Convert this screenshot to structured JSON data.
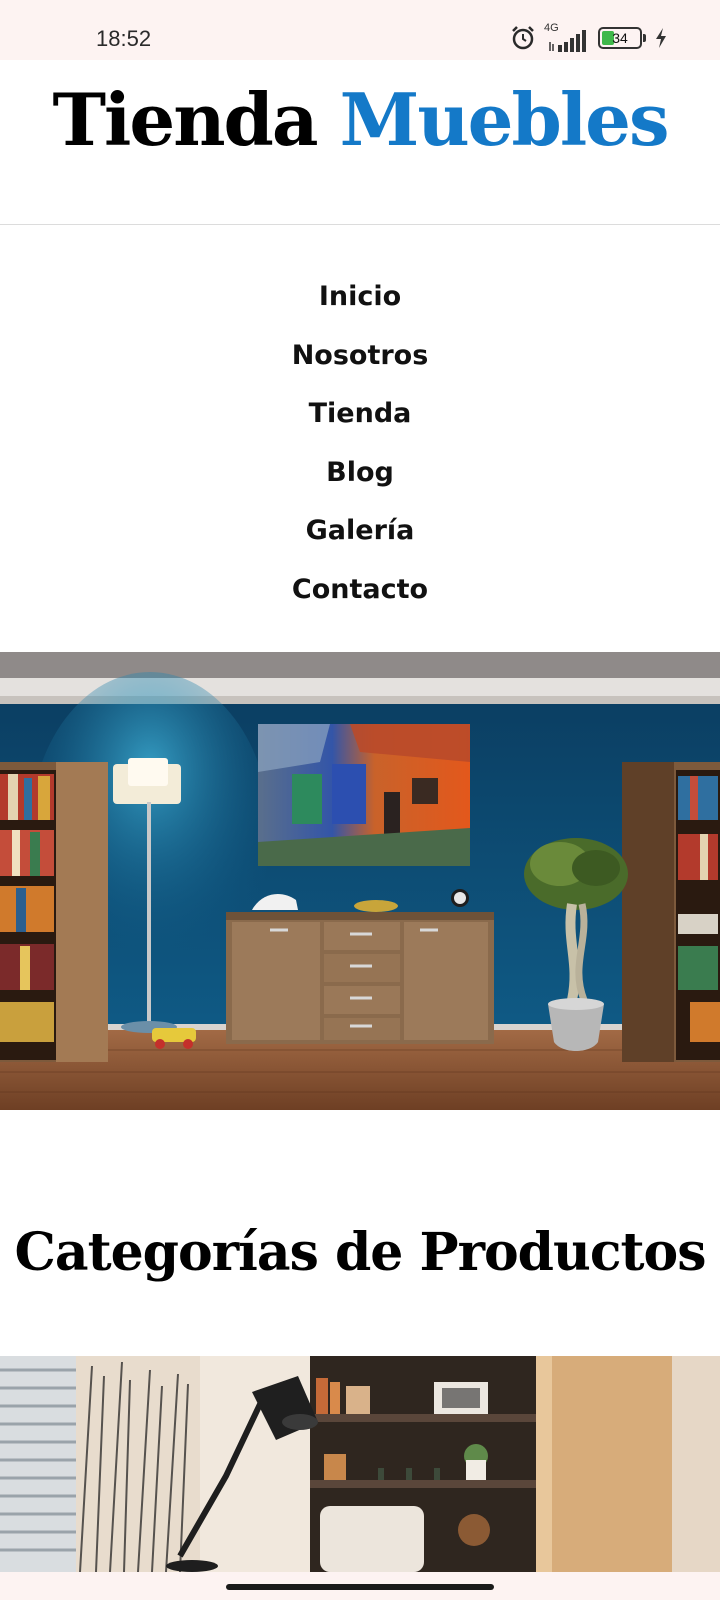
{
  "status_bar": {
    "time": "18:52",
    "network": "4G",
    "battery_level": "34",
    "battery_fraction": 0.34,
    "icons": [
      "alarm-icon",
      "signal-icon",
      "battery-icon",
      "charging-bolt-icon"
    ]
  },
  "header": {
    "title_part1": "Tienda",
    "title_part2": "Muebles",
    "accent_color": "#1479c8"
  },
  "nav": {
    "items": [
      {
        "label": "Inicio"
      },
      {
        "label": "Nosotros"
      },
      {
        "label": "Tienda"
      },
      {
        "label": "Blog"
      },
      {
        "label": "Galería"
      },
      {
        "label": "Contacto"
      }
    ]
  },
  "sections": {
    "categories_title": "Categorías de Productos"
  }
}
